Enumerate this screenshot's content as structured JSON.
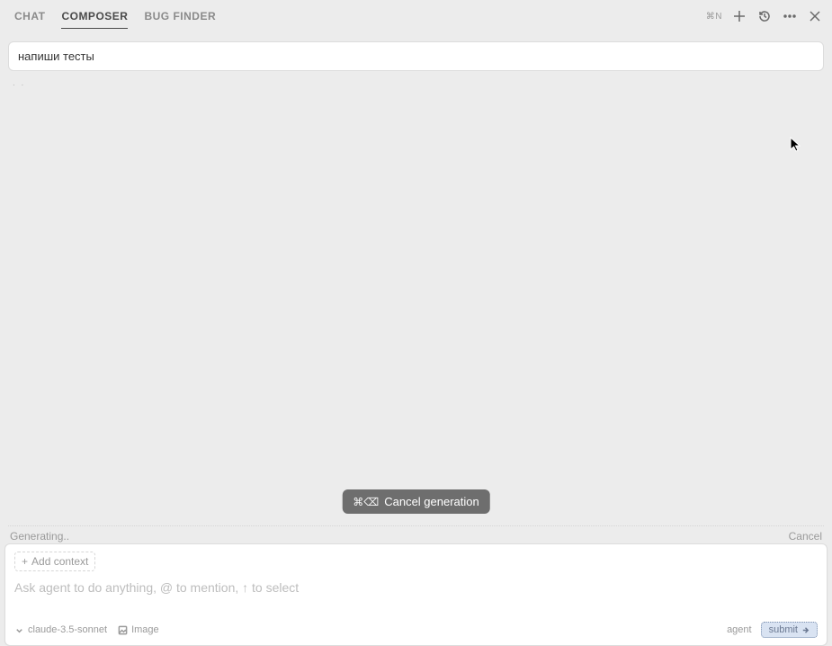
{
  "topbar": {
    "tabs": {
      "chat": "CHAT",
      "composer": "COMPOSER",
      "bugfinder": "BUG FINDER"
    },
    "shortcut": "⌘N"
  },
  "message": {
    "text": "напиши тесты"
  },
  "generating_dots": ". .",
  "cancel_generation": {
    "shortcut": "⌘⌫",
    "label": "Cancel generation"
  },
  "status": {
    "generating": "Generating..",
    "cancel": "Cancel"
  },
  "input": {
    "add_context": "Add context",
    "placeholder": "Ask agent to do anything, @ to mention, ↑ to select"
  },
  "footer": {
    "model": "claude-3.5-sonnet",
    "image": "Image",
    "agent": "agent",
    "submit": "submit"
  }
}
